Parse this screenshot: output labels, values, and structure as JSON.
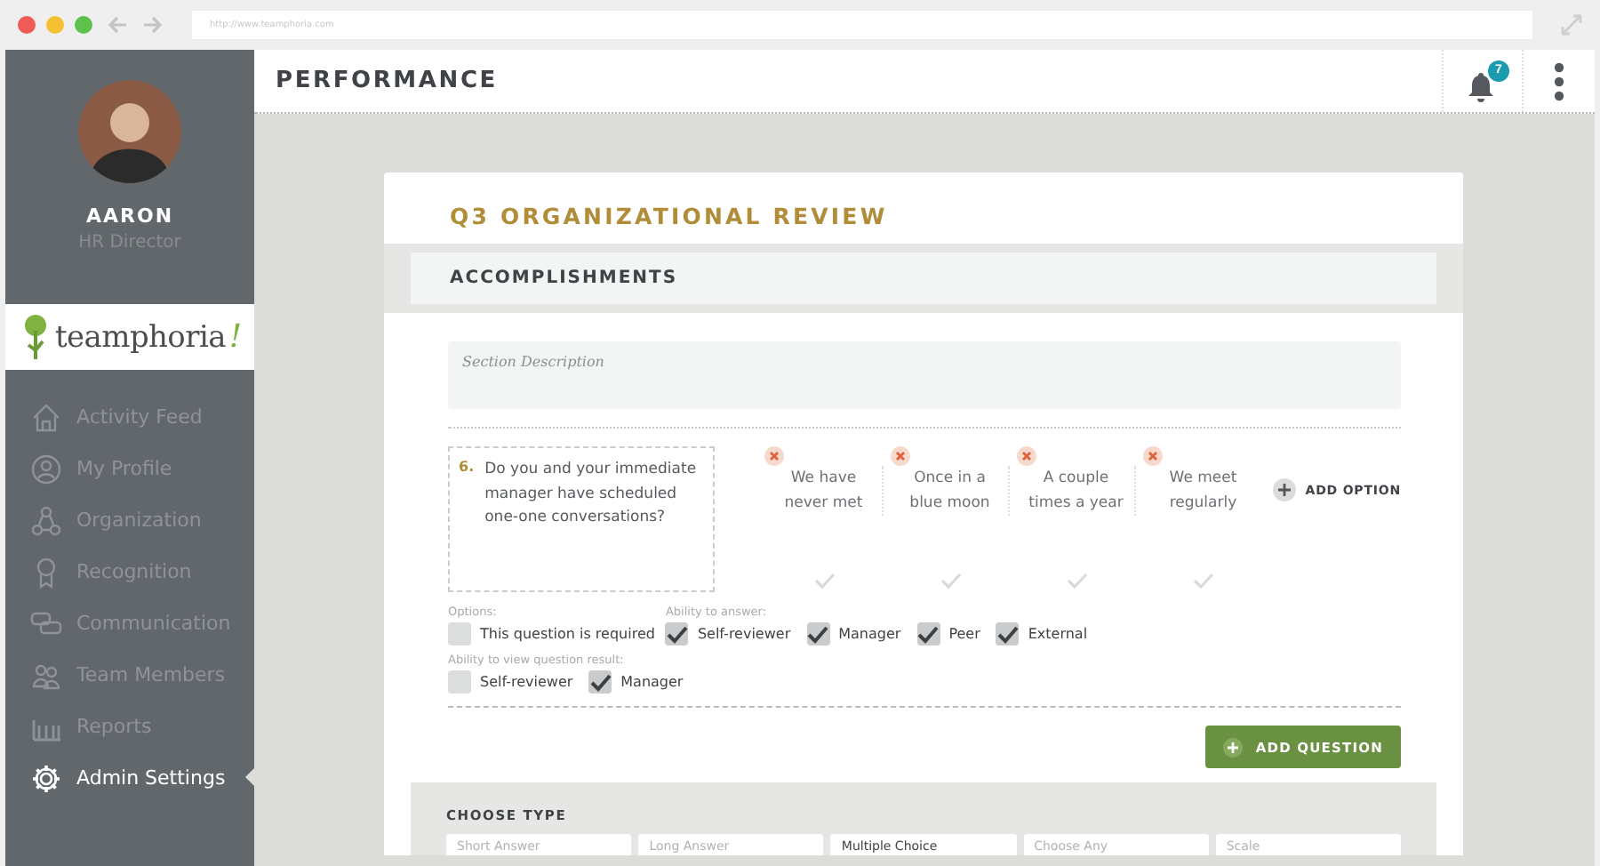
{
  "browser": {
    "url": "http://www.teamphoria.com"
  },
  "profile": {
    "name": "AARON",
    "role": "HR Director"
  },
  "logo": {
    "text": "teamphoria",
    "mark": "!"
  },
  "sidebar": {
    "items": [
      {
        "label": "Activity Feed",
        "kind": "home",
        "selected": false
      },
      {
        "label": "My Profile",
        "kind": "person",
        "selected": false
      },
      {
        "label": "Organization",
        "kind": "org",
        "selected": false
      },
      {
        "label": "Recognition",
        "kind": "award",
        "selected": false
      },
      {
        "label": "Communication",
        "kind": "chat",
        "selected": false
      },
      {
        "label": "Team Members",
        "kind": "team",
        "selected": false
      },
      {
        "label": "Reports",
        "kind": "bars",
        "selected": false
      },
      {
        "label": "Admin Settings",
        "kind": "gear",
        "selected": true
      }
    ]
  },
  "header": {
    "title": "PERFORMANCE",
    "notifications": "7"
  },
  "review": {
    "title": "Q3 ORGANIZATIONAL REVIEW",
    "section": "ACCOMPLISHMENTS",
    "description_placeholder": "Section Description",
    "question": {
      "number": "6.",
      "text": "Do you and your immediate manager have scheduled one-one conversations?",
      "options": [
        {
          "label": "We have never met",
          "checked": false
        },
        {
          "label": "Once in a blue moon",
          "checked": false
        },
        {
          "label": "A couple times a year",
          "checked": false
        },
        {
          "label": "We meet regularly",
          "checked": false
        }
      ],
      "add_option": "ADD OPTION",
      "options_label": "Options:",
      "required": {
        "label": "This question is required",
        "checked": false
      },
      "answer_label": "Ability to answer:",
      "answer": [
        {
          "label": "Self-reviewer",
          "checked": true
        },
        {
          "label": "Manager",
          "checked": true
        },
        {
          "label": "Peer",
          "checked": true
        },
        {
          "label": "External",
          "checked": true
        }
      ],
      "view_label": "Ability to view question result:",
      "view": [
        {
          "label": "Self-reviewer",
          "checked": false
        },
        {
          "label": "Manager",
          "checked": true
        }
      ]
    },
    "add_question": "ADD QUESTION",
    "choose_type": {
      "title": "CHOOSE TYPE",
      "types": [
        {
          "label": "Short Answer",
          "selected": false
        },
        {
          "label": "Long Answer",
          "selected": false
        },
        {
          "label": "Multiple Choice",
          "selected": true
        },
        {
          "label": "Choose Any",
          "selected": false
        },
        {
          "label": "Scale",
          "selected": false
        }
      ]
    }
  }
}
